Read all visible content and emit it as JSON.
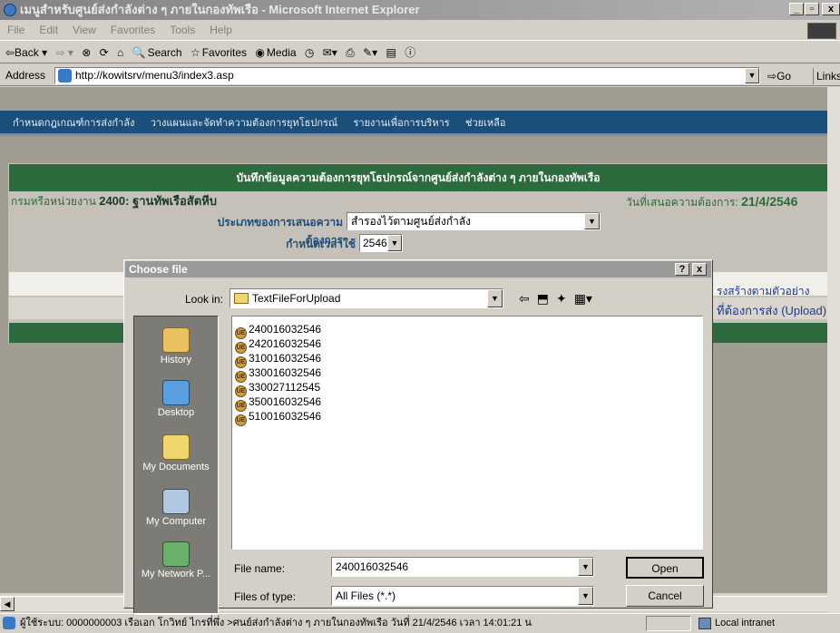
{
  "window": {
    "title": "เมนูสำหรับศูนย์ส่งกำลังต่าง ๆ ภายในกองทัพเรือ - Microsoft Internet Explorer",
    "min": "_",
    "max": "▫",
    "close": "x"
  },
  "menu": [
    "File",
    "Edit",
    "View",
    "Favorites",
    "Tools",
    "Help"
  ],
  "toolbar": {
    "back": "⇦Back ▾",
    "forward": "⇨ ▾",
    "search": "Search",
    "favorites": "Favorites",
    "media": "Media"
  },
  "address": {
    "label": "Address",
    "url": "http://kowitsrv/menu3/index3.asp",
    "go": "Go",
    "links": "Links"
  },
  "nav": [
    "กำหนดกฎเกณฑ์การส่งกำลัง",
    "วางแผนและจัดทำความต้องการยุทโธปกรณ์",
    "รายงานเพื่อการบริหาร",
    "ช่วยเหลือ"
  ],
  "form": {
    "header": "บันทึกข้อมูลความต้องการยุทโธปกรณ์จากศูนย์ส่งกำลังต่าง ๆ ภายในกองทัพเรือ",
    "unit_label": "กรมหรือหน่วยงาน",
    "unit_value": "2400: ฐานทัพเรือสัตหีบ",
    "date_label": "วันที่เสนอความต้องการ:",
    "date_value": "21/4/2546",
    "type_label": "ประเภทของการเสนอความต้องการ",
    "type_value": "สำรองไว้ตามศูนย์ส่งกำลัง",
    "period_label": "กำหนดเวลาใช้",
    "period_value": "2546",
    "link1": "รงสร้างตามตัวอย่าง",
    "link2": "ที่ต้องการส่ง (Upload)"
  },
  "dialog": {
    "title": "Choose file",
    "help": "?",
    "close": "x",
    "lookin_label": "Look in:",
    "lookin_value": "TextFileForUpload",
    "places": [
      "History",
      "Desktop",
      "My Documents",
      "My Computer",
      "My Network P..."
    ],
    "files": [
      "240016032546",
      "242016032546",
      "310016032546",
      "330016032546",
      "330027112545",
      "350016032546",
      "510016032546"
    ],
    "filename_label": "File name:",
    "filename_value": "240016032546",
    "filetype_label": "Files of type:",
    "filetype_value": "All Files (*.*)",
    "open": "Open",
    "cancel": "Cancel"
  },
  "status": {
    "text": "ผู้ใช้ระบบ: 0000000003 เรือเอก โกวิทย์ ไกรที่พึ่ง >ศนย์ส่งกำลังต่าง ๆ ภายในกองทัพเรือ วันที่ 21/4/2546 เวลา 14:01:21 น",
    "zone": "Local intranet"
  }
}
